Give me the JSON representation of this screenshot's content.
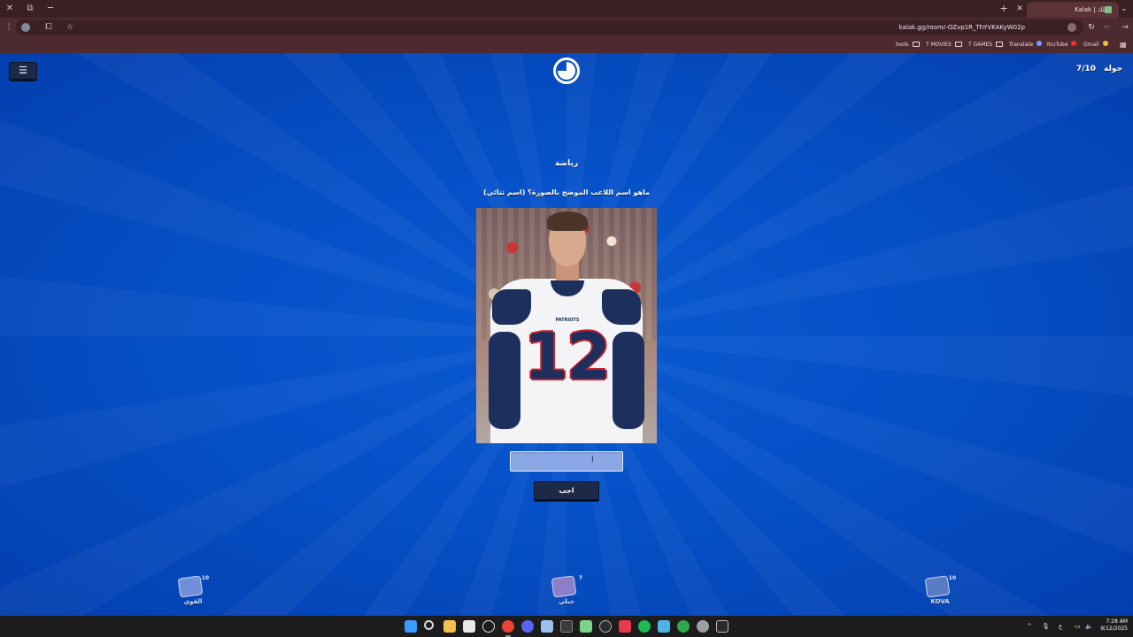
{
  "browser": {
    "tab_title": "Kalak | كلك",
    "url": "kalak.gg/room/-OZvp1R_ThYVKAKyW02p",
    "bookmarks": [
      "tools",
      "T MOVIES",
      "T GAMES",
      "Translate",
      "YouTube",
      "Gmail"
    ],
    "icons": {
      "close_window": "close-icon",
      "restore_window": "restore-icon",
      "minimize_window": "minimize-icon",
      "new_tab": "plus-icon",
      "reload": "reload-icon",
      "back": "back-arrow-icon",
      "forward": "forward-arrow-icon",
      "bookmark_star": "star-icon",
      "extensions": "extensions-icon",
      "apps": "apps-grid-icon"
    }
  },
  "game": {
    "round_label": "جولة",
    "round_value": "7/10",
    "timer_remaining_fraction": 0.75,
    "category": "رياضة",
    "question": "ماهو اسم اللاعب الموضح بالصورة؟ (اسم ثنائي)",
    "photo_alt": "football player wearing number 12",
    "jersey_number": "12",
    "jersey_team_text": "PATRIOTS",
    "answer_value": "",
    "submit_label": "اجب",
    "players": [
      {
        "name": "القوي",
        "score": "10"
      },
      {
        "name": "جبلي",
        "score": "7"
      },
      {
        "name": "KOVA",
        "score": "10"
      }
    ],
    "colors": {
      "background": "#0650c8",
      "button": "#1c2a48",
      "input": "#8aa8e6"
    }
  },
  "taskbar": {
    "time": "7:28 AM",
    "date": "9/12/2025",
    "language": "ع",
    "apps": [
      "start-icon",
      "search-icon",
      "file-explorer-icon",
      "store-icon",
      "chatgpt-icon",
      "chrome-icon",
      "discord-icon",
      "notepad-icon",
      "excel-icon",
      "app-icon",
      "obs-icon",
      "capcut-icon",
      "spotify-icon",
      "photos-icon",
      "xbox-icon",
      "settings-icon",
      "terminal-icon"
    ]
  }
}
